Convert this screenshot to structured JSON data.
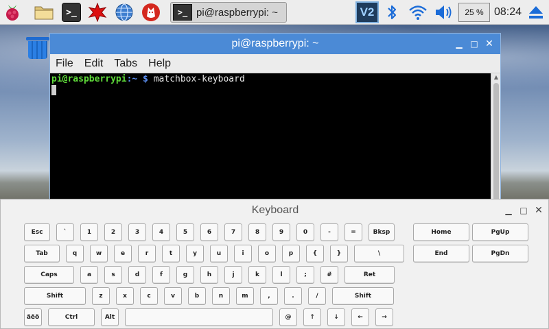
{
  "panel": {
    "taskbar_terminal_label": "pi@raspberrypi: ~",
    "terminal_icon_glyph": ">_",
    "vnc_label": "V2",
    "cpu_usage": "25 %",
    "clock": "08:24"
  },
  "terminal": {
    "title": "pi@raspberrypi: ~",
    "menu": [
      "File",
      "Edit",
      "Tabs",
      "Help"
    ],
    "prompt_user": "pi@raspberrypi",
    "prompt_path": ":~ $ ",
    "command": "matchbox-keyboard"
  },
  "keyboard": {
    "title": "Keyboard",
    "rows": [
      [
        "Esc",
        "`",
        "1",
        "2",
        "3",
        "4",
        "5",
        "6",
        "7",
        "8",
        "9",
        "0",
        "-",
        "=",
        "Bksp"
      ],
      [
        "Tab",
        "q",
        "w",
        "e",
        "r",
        "t",
        "y",
        "u",
        "i",
        "o",
        "p",
        "{",
        "}",
        "\\"
      ],
      [
        "Caps",
        "a",
        "s",
        "d",
        "f",
        "g",
        "h",
        "j",
        "k",
        "l",
        ";",
        "#",
        "Ret"
      ],
      [
        "Shift",
        "z",
        "x",
        "c",
        "v",
        "b",
        "n",
        "m",
        ",",
        ".",
        "/",
        "Shift"
      ],
      [
        "äëö",
        "Ctrl",
        "Alt",
        "",
        "@",
        "↑",
        "↓",
        "←",
        "→"
      ]
    ],
    "nav_keys": [
      [
        "Home",
        "PgUp"
      ],
      [
        "End",
        "PgDn"
      ]
    ]
  },
  "colors": {
    "titlebar_active": "#4b8ad6",
    "prompt_user": "#5fdc3a",
    "prompt_path": "#5b8ef0"
  }
}
